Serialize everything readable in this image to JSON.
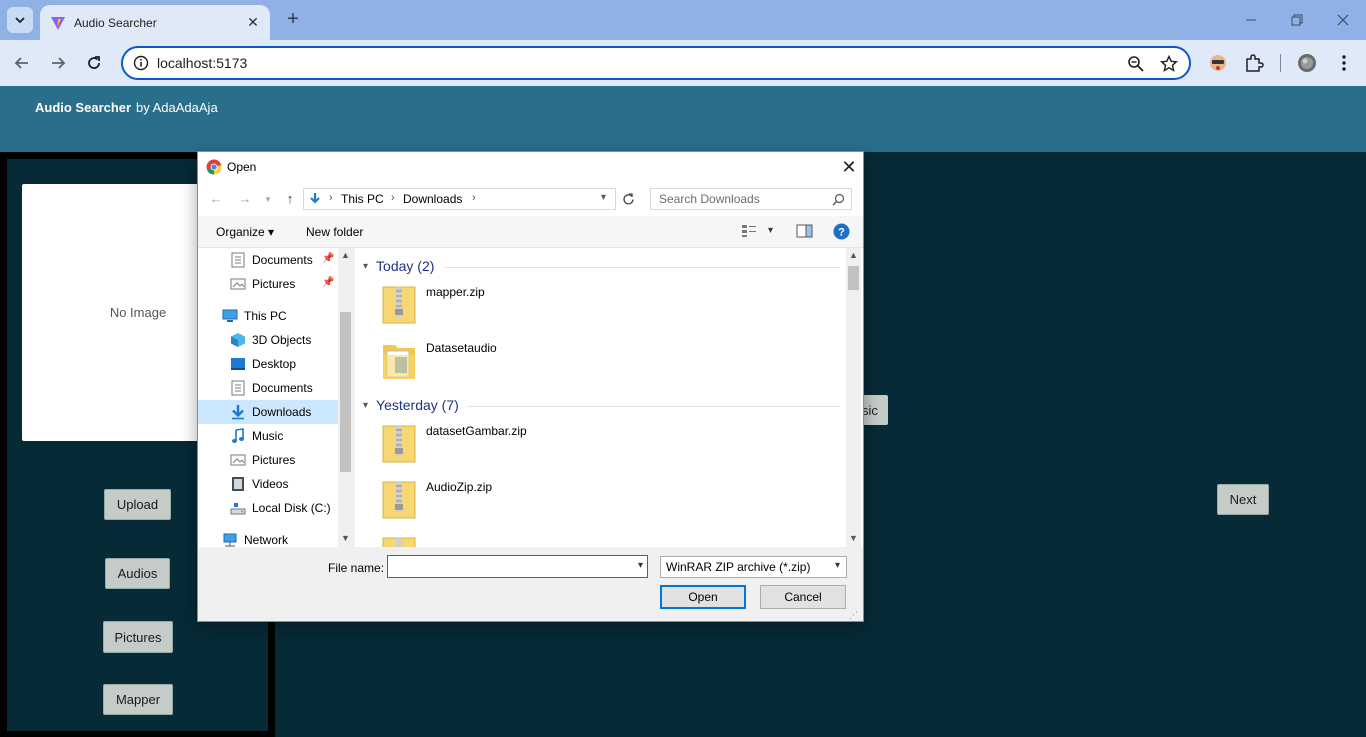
{
  "browser": {
    "tab_title": "Audio Searcher",
    "url": "localhost:5173",
    "new_tab_symbol": "+",
    "tab_close_symbol": "✕"
  },
  "app": {
    "title": "Audio Searcher",
    "byline": "by AdaAdaAja",
    "no_image_text": "No Image",
    "buttons": {
      "upload": "Upload",
      "audios": "Audios",
      "pictures": "Pictures",
      "mapper": "Mapper",
      "next": "Next",
      "music_partial": "sic"
    }
  },
  "dialog": {
    "title": "Open",
    "breadcrumb": [
      "This PC",
      "Downloads"
    ],
    "search_placeholder": "Search Downloads",
    "organize_label": "Organize ▾",
    "new_folder_label": "New folder",
    "nav_items": [
      {
        "label": "Documents",
        "icon": "documents-icon",
        "pinned": true
      },
      {
        "label": "Pictures",
        "icon": "pictures-icon",
        "pinned": true
      },
      {
        "label": "This PC",
        "icon": "computer-icon",
        "pinned": false
      },
      {
        "label": "3D Objects",
        "icon": "3d-objects-icon",
        "pinned": false
      },
      {
        "label": "Desktop",
        "icon": "desktop-icon",
        "pinned": false
      },
      {
        "label": "Documents",
        "icon": "documents-icon",
        "pinned": false
      },
      {
        "label": "Downloads",
        "icon": "downloads-icon",
        "pinned": false,
        "selected": true
      },
      {
        "label": "Music",
        "icon": "music-icon",
        "pinned": false
      },
      {
        "label": "Pictures",
        "icon": "pictures-icon",
        "pinned": false
      },
      {
        "label": "Videos",
        "icon": "videos-icon",
        "pinned": false
      },
      {
        "label": "Local Disk (C:)",
        "icon": "drive-icon",
        "pinned": false
      },
      {
        "label": "Network",
        "icon": "network-icon",
        "pinned": false
      }
    ],
    "groups": [
      {
        "label": "Today (2)",
        "files": [
          {
            "name": "mapper.zip",
            "icon": "zip-folder-icon"
          },
          {
            "name": "Datasetaudio",
            "icon": "folder-icon"
          }
        ]
      },
      {
        "label": "Yesterday (7)",
        "files": [
          {
            "name": "datasetGambar.zip",
            "icon": "zip-folder-icon"
          },
          {
            "name": "AudioZip.zip",
            "icon": "zip-folder-icon"
          },
          {
            "name": "",
            "icon": "zip-folder-icon"
          }
        ]
      }
    ],
    "file_name_label": "File name:",
    "file_name_value": "",
    "file_type_filter": "WinRAR ZIP archive (*.zip)",
    "open_button": "Open",
    "cancel_button": "Cancel"
  }
}
